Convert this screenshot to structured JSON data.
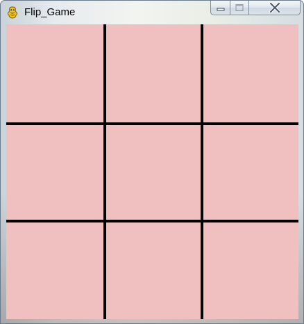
{
  "window": {
    "title": "Flip_Game",
    "app_icon": "python-snake-icon",
    "controls": {
      "minimize_icon": "minimize-icon",
      "maximize_icon": "maximize-icon",
      "close_icon": "close-icon"
    }
  },
  "board": {
    "rows": 3,
    "cols": 3,
    "cell_color": "#f0bfbf",
    "line_color": "#000000",
    "cells": [
      {
        "row": 1,
        "col": 1
      },
      {
        "row": 1,
        "col": 2
      },
      {
        "row": 1,
        "col": 3
      },
      {
        "row": 2,
        "col": 1
      },
      {
        "row": 2,
        "col": 2
      },
      {
        "row": 2,
        "col": 3
      },
      {
        "row": 3,
        "col": 1
      },
      {
        "row": 3,
        "col": 2
      },
      {
        "row": 3,
        "col": 3
      }
    ]
  }
}
